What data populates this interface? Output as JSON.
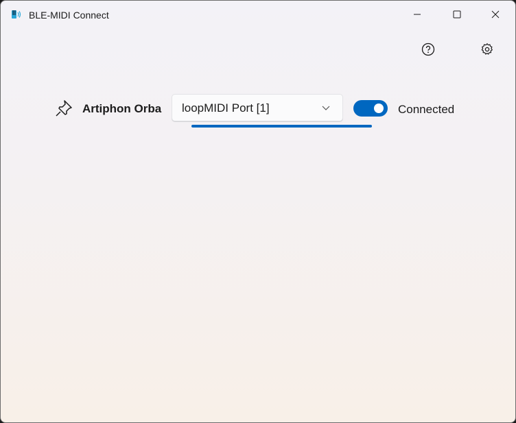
{
  "window": {
    "title": "BLE-MIDI Connect",
    "app_icon": "piano-bluetooth-icon"
  },
  "caption_buttons": [
    "minimize",
    "maximize",
    "close"
  ],
  "toolbar": {
    "help_icon": "help-circle-icon",
    "settings_icon": "gear-icon"
  },
  "device": {
    "pin_icon": "pin-icon",
    "name": "Artiphon Orba",
    "port_selected": "loopMIDI Port [1]",
    "toggle_on": true,
    "status": "Connected"
  },
  "colors": {
    "accent": "#0067c0"
  }
}
